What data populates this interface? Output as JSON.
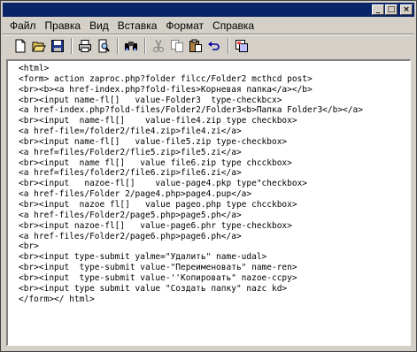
{
  "window": {
    "title": ""
  },
  "title_buttons": {
    "minimize": "_",
    "maximize": "□",
    "close": "×"
  },
  "menu": [
    "Файл",
    "Правка",
    "Вид",
    "Вставка",
    "Формат",
    "Справка"
  ],
  "toolbar": {
    "icons": [
      "new-document-icon",
      "open-folder-icon",
      "save-icon",
      "print-icon",
      "print-preview-icon",
      "find-icon",
      "cut-icon",
      "copy-icon",
      "paste-icon",
      "undo-icon",
      "insert-object-icon"
    ]
  },
  "editor": {
    "lines": [
      "<html>",
      "<form> action zaproc.php?folder filcc/Folder2 mcthcd post>",
      "<br><b><a href-index.php?fold-files>Корневая папка</a></b>",
      "<br><input name-fl[]   value-Folder3  type-checkbcx>",
      "<a href-index.php?fold-files/Folder2/Folder3<b>Папка Folder3</b></a>",
      "<br><input  name-fl[]    value-file4.zip type checkbox>",
      "<a href-file=/folder2/file4.zip>file4.zi</a>",
      "<br><input name-fl[]   value-file5.zip type-checkbox>",
      "<a href=files/Folder2/flie5.zip>file5.zi</a>",
      "<br><input  name fl[]   value file6.zip type chcckbox>",
      "<a href=files/folder2/file6.zip>file6.zi</a>",
      "<br><input   nazoe-fl[]    value-page4.pkp type\"checkbox>",
      "<a href-files/Folder 2/page4.php>page4.pup</a>",
      "<br><input  nazoe fl[]   value pageo.php type chcckbox>",
      "<a href-files/Folder2/page5.php>page5.ph</a>",
      "<br><input nazoe-fl[]   value-page6.phr type-checkbox>",
      "<a href-files/Folder2/page6.php>page6.ph</a>",
      "<br>",
      "<br><input type-submit yalme=\"Удалить\" name-udal>",
      "<br><input  type-submit value-\"Переименовать\" name-ren>",
      "<br><input  type-submit value-''Копировать\" nazoe-ccpy>",
      "<br><input type submit value \"Создать папку\" nazc kd>",
      "</form></ html>"
    ]
  }
}
